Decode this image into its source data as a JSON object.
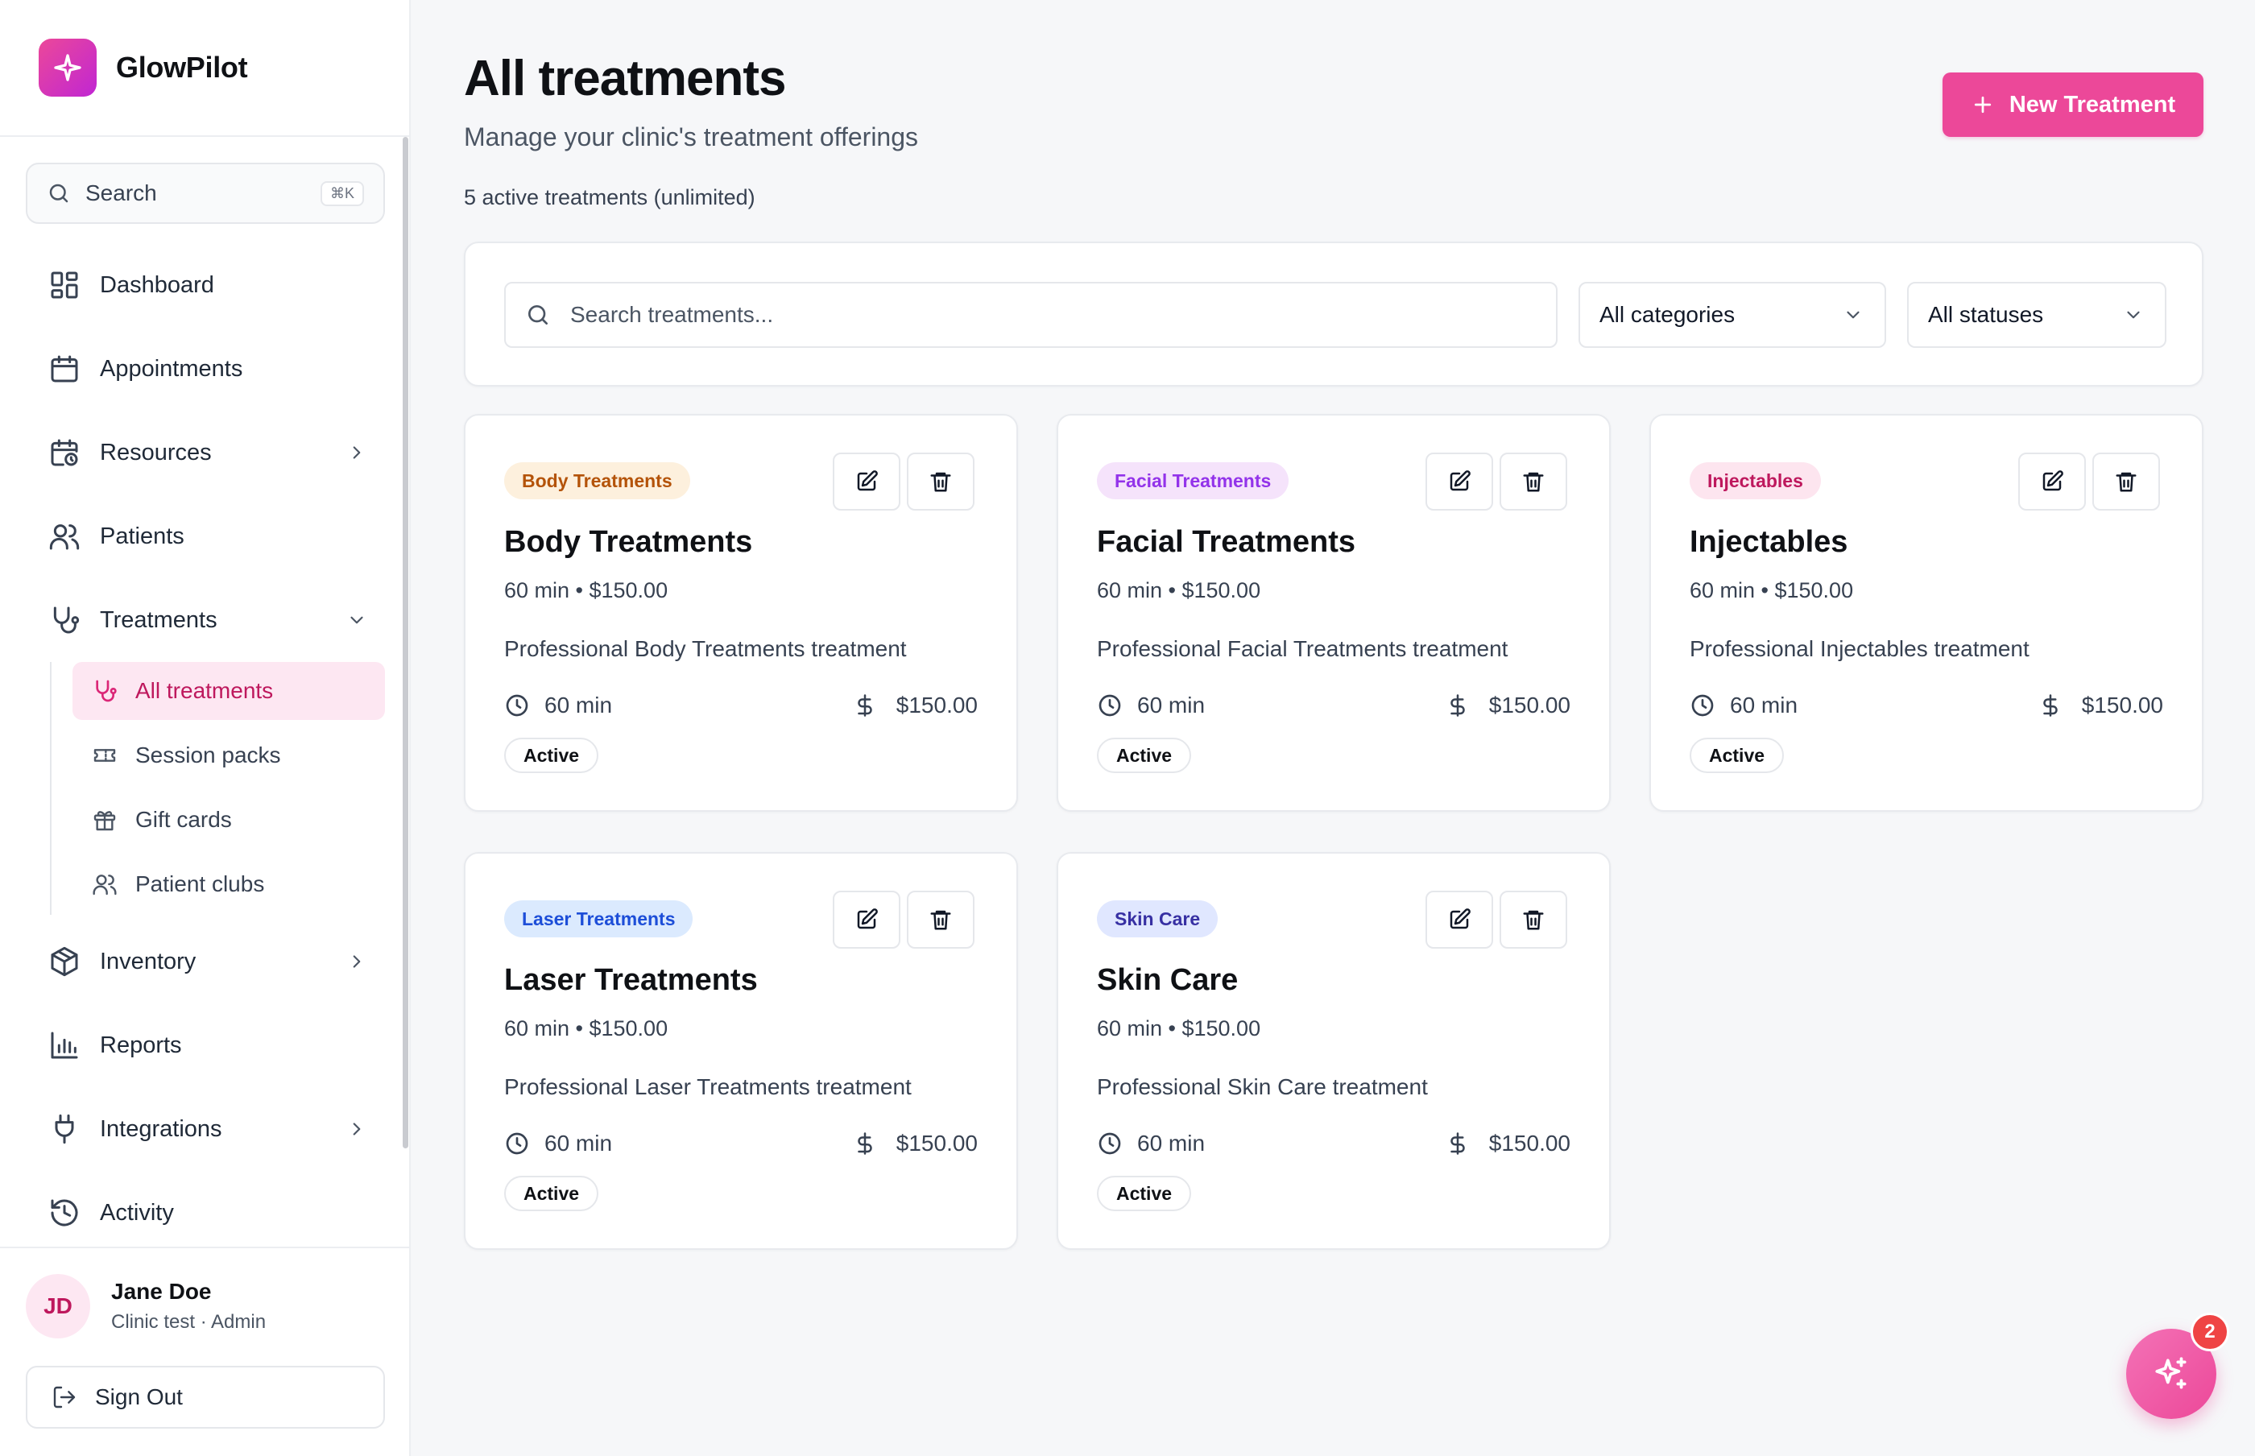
{
  "app": {
    "name": "GlowPilot"
  },
  "sidebar": {
    "search_label": "Search",
    "search_shortcut": "⌘K",
    "items": [
      {
        "label": "Dashboard"
      },
      {
        "label": "Appointments"
      },
      {
        "label": "Resources"
      },
      {
        "label": "Patients"
      },
      {
        "label": "Treatments"
      },
      {
        "label": "Inventory"
      },
      {
        "label": "Reports"
      },
      {
        "label": "Integrations"
      },
      {
        "label": "Activity"
      }
    ],
    "sub_items": [
      {
        "label": "All treatments"
      },
      {
        "label": "Session packs"
      },
      {
        "label": "Gift cards"
      },
      {
        "label": "Patient clubs"
      }
    ],
    "user": {
      "initials": "JD",
      "name": "Jane Doe",
      "role": "Clinic test · Admin"
    },
    "signout_label": "Sign Out"
  },
  "header": {
    "title": "All treatments",
    "subtitle": "Manage your clinic's treatment offerings",
    "count_text": "5 active treatments (unlimited)",
    "new_button_label": "New Treatment"
  },
  "filters": {
    "search_placeholder": "Search treatments...",
    "category_value": "All categories",
    "status_value": "All statuses"
  },
  "cards": [
    {
      "category": "Body Treatments",
      "title": "Body Treatments",
      "meta": "60 min • $150.00",
      "description": "Professional Body Treatments treatment",
      "duration": "60 min",
      "price": "$150.00",
      "status": "Active",
      "badge_bg": "#fdf0dd",
      "badge_fg": "#b45309"
    },
    {
      "category": "Facial Treatments",
      "title": "Facial Treatments",
      "meta": "60 min • $150.00",
      "description": "Professional Facial Treatments treatment",
      "duration": "60 min",
      "price": "$150.00",
      "status": "Active",
      "badge_bg": "#f5e3fb",
      "badge_fg": "#9333ea"
    },
    {
      "category": "Injectables",
      "title": "Injectables",
      "meta": "60 min • $150.00",
      "description": "Professional Injectables treatment",
      "duration": "60 min",
      "price": "$150.00",
      "status": "Active",
      "badge_bg": "#fde5ef",
      "badge_fg": "#be185d"
    },
    {
      "category": "Laser Treatments",
      "title": "Laser Treatments",
      "meta": "60 min • $150.00",
      "description": "Professional Laser Treatments treatment",
      "duration": "60 min",
      "price": "$150.00",
      "status": "Active",
      "badge_bg": "#dbeafe",
      "badge_fg": "#1d4ed8"
    },
    {
      "category": "Skin Care",
      "title": "Skin Care",
      "meta": "60 min • $150.00",
      "description": "Professional Skin Care treatment",
      "duration": "60 min",
      "price": "$150.00",
      "status": "Active",
      "badge_bg": "#e0e7ff",
      "badge_fg": "#3730a3"
    }
  ],
  "assistant": {
    "notification_count": "2"
  },
  "colors": {
    "accent": "#ec4899",
    "accent_soft": "#fde7f2",
    "notification": "#ef4444"
  }
}
